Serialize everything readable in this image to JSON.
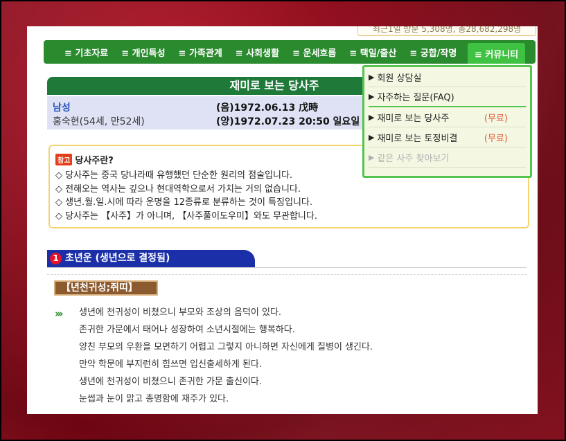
{
  "header": {
    "visit_counter": "최근1일 방문 5,308명, 총28,682,298명"
  },
  "nav": {
    "items": [
      {
        "label": "≡ 기초자료"
      },
      {
        "label": "≡ 개인특성"
      },
      {
        "label": "≡ 가족관계"
      },
      {
        "label": "≡ 사회생활"
      },
      {
        "label": "≡ 운세흐름"
      },
      {
        "label": "≡ 택일/출산"
      },
      {
        "label": "≡ 궁합/작명"
      },
      {
        "label": "≡ 커뮤니티"
      }
    ]
  },
  "dropdown": {
    "items": [
      {
        "label": "회원 상담실",
        "extra": ""
      },
      {
        "label": "자주하는 질문(FAQ)",
        "extra": ""
      },
      {
        "label": "재미로 보는 당사주",
        "extra": "(무료)"
      },
      {
        "label": "재미로 보는 토정비결",
        "extra": "(무료)"
      },
      {
        "label": "같은 사주 찾아보기",
        "extra": ""
      }
    ],
    "arrow": "▶"
  },
  "main": {
    "title": "재미로 보는 당사주",
    "person": {
      "gender": "남성",
      "name": "홍숙현(54세, 만52세)",
      "lunar": "(음)1972.06.13 戊時",
      "solar": "(양)1972.07.23 20:50 일요일"
    },
    "info": {
      "badge": "참고",
      "heading": "당사주란?",
      "lines": [
        "◇ 당사주는 중국 당나라때 유행했던 단순한 원리의 점술입니다.",
        "◇ 전해오는 역사는 깊으나 현대역학으로서 가치는 거의 없습니다.",
        "◇ 생년.월.일.시에 따라 운명을 12종류로 분류하는 것이 특징입니다.",
        "◇ 당사주는 【사주】가 아니며, 【사주풀이도우미】와도 무관합니다."
      ]
    },
    "section1": {
      "number": "1",
      "title": "초년운 (생년으로 결정됨)",
      "tag": "【년천귀성;쥐띠】",
      "lines": [
        "생년에 천귀성이 비쳤으니 부모와 조상의 음덕이 있다.",
        "존귀한 가문에서 태어나 성장하여 소년시절에는 행복하다.",
        "양친 부모의 우환을 모면하기 어렵고 그렇지 아니하면 자신에게 질병이 생긴다.",
        "만약 학문에 부지런히 힘쓰면 입신출세하게 된다.",
        "생년에 천귀성이 비쳤으니 존귀한 가문 출신이다.",
        "눈썹과 눈이 맑고 총명함에 재주가 있다."
      ]
    }
  },
  "colors": {
    "nav_bg": "#2a8a2e",
    "active_tab": "#3fc241",
    "title_bg": "#1f7a3a",
    "section_bg": "#1a2fa8",
    "free_text": "#e05c38"
  }
}
